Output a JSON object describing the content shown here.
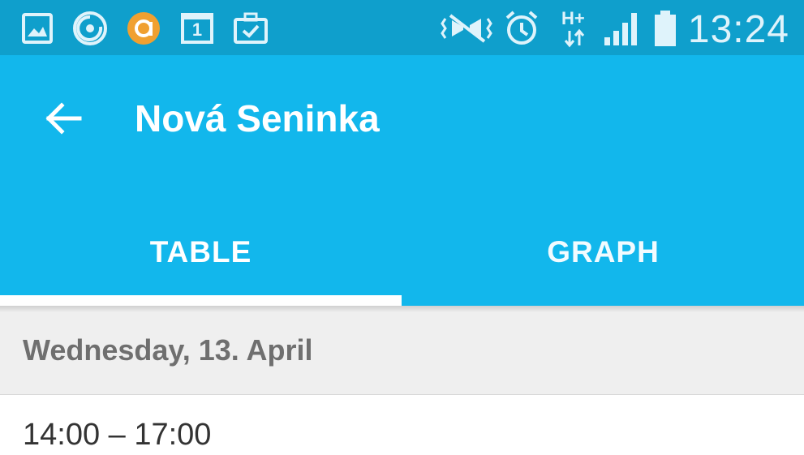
{
  "status_bar": {
    "time": "13:24",
    "network_label": "H+",
    "calendar_day": "1",
    "left_icons": [
      "gallery-icon",
      "sync-icon",
      "avast-icon",
      "calendar-icon",
      "briefcase-check-icon"
    ],
    "right_icons": [
      "vibrate-icon",
      "alarm-icon",
      "network-hplus-icon",
      "signal-icon",
      "battery-icon"
    ]
  },
  "app_bar": {
    "title": "Nová Seninka",
    "back_icon": "arrow-left-icon",
    "tabs": [
      {
        "label": "TABLE",
        "selected": true
      },
      {
        "label": "GRAPH",
        "selected": false
      }
    ]
  },
  "content": {
    "date_header": "Wednesday, 13. April",
    "rows": [
      {
        "time_range": "14:00 – 17:00"
      }
    ]
  },
  "colors": {
    "status_bar": "#0f9fcc",
    "app_bar": "#12b7ec",
    "indicator": "#ffffff",
    "date_header_bg": "#efefef"
  }
}
